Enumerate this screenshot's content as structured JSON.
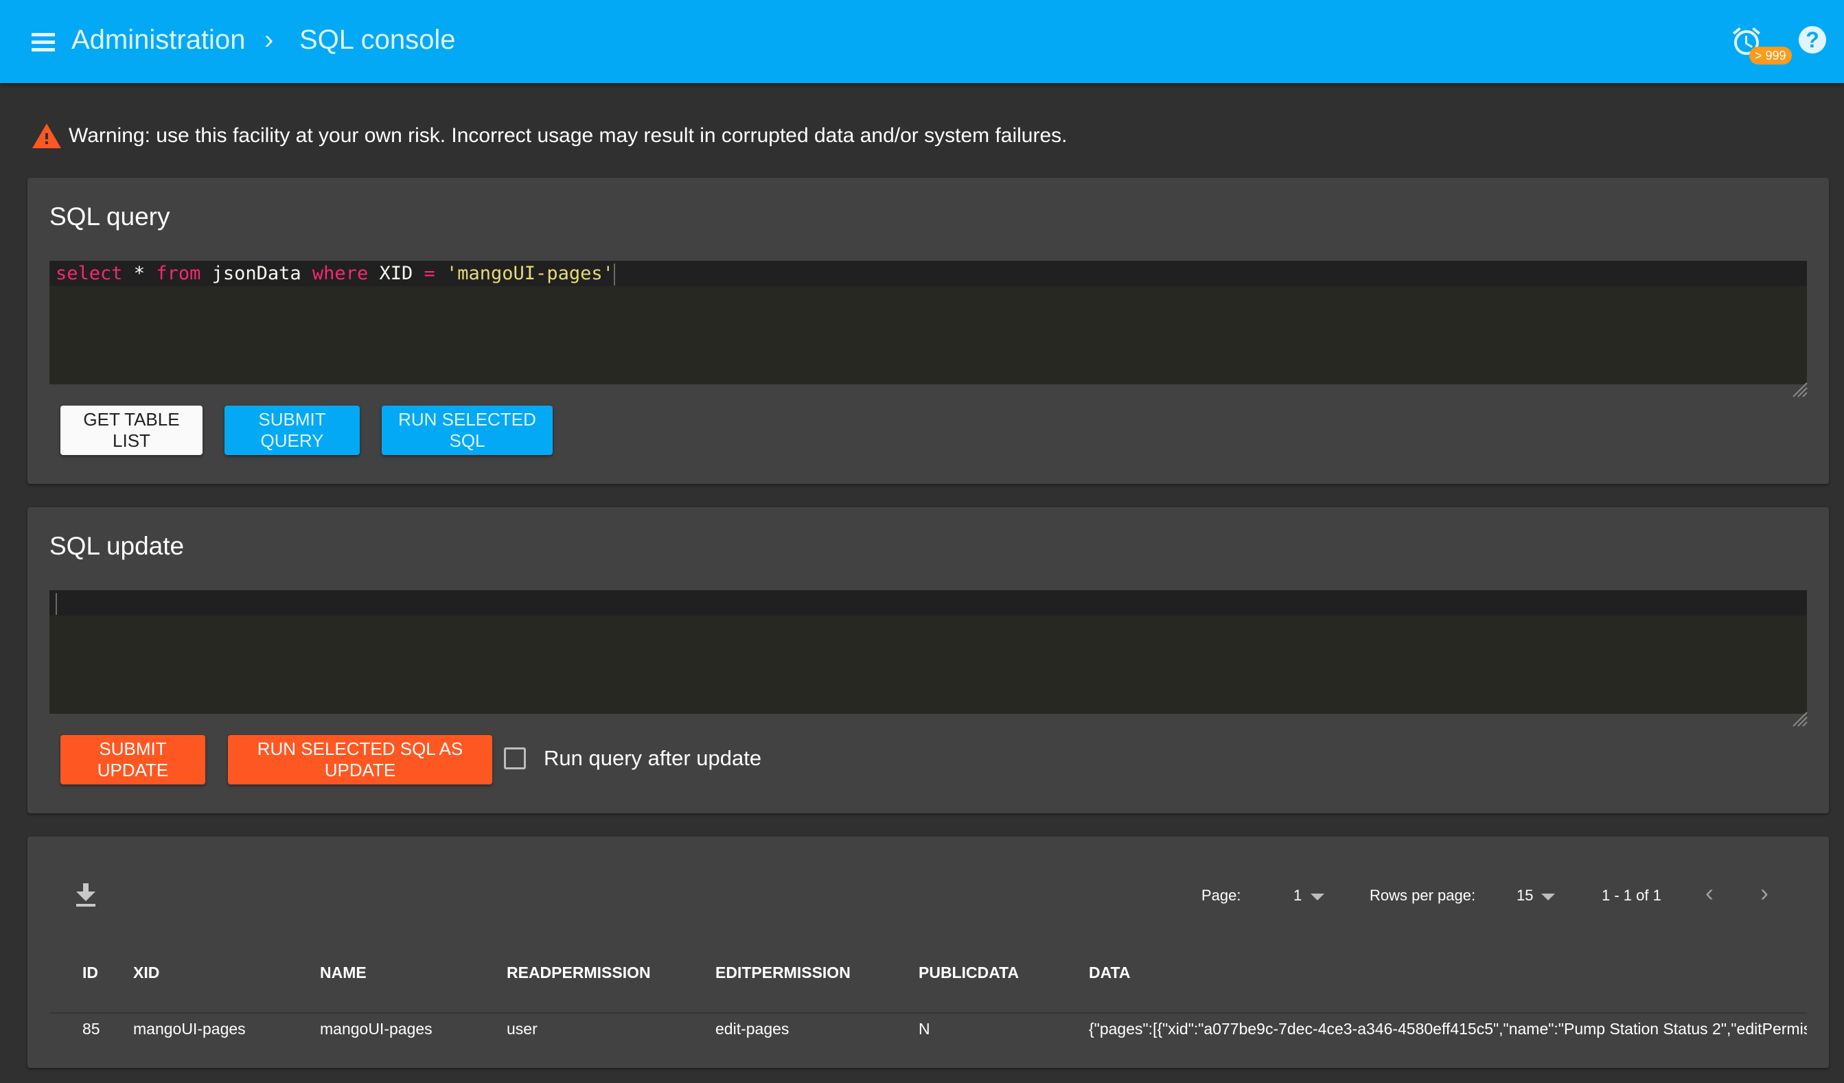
{
  "header": {
    "breadcrumb_parent": "Administration",
    "breadcrumb_separator": "›",
    "breadcrumb_current": "SQL console",
    "alarm_badge": "> 999",
    "help_label": "?"
  },
  "warning": {
    "text": "Warning: use this facility at your own risk. Incorrect usage may result in corrupted data and/or system failures."
  },
  "query_card": {
    "title": "SQL query",
    "editor": {
      "tokens": [
        {
          "type": "kw",
          "text": "select"
        },
        {
          "type": "id",
          "text": " * "
        },
        {
          "type": "kw",
          "text": "from"
        },
        {
          "type": "id",
          "text": " jsonData "
        },
        {
          "type": "kw",
          "text": "where"
        },
        {
          "type": "id",
          "text": " XID "
        },
        {
          "type": "kw",
          "text": "="
        },
        {
          "type": "id",
          "text": " "
        },
        {
          "type": "str",
          "text": "'mangoUI-pages'"
        }
      ]
    },
    "buttons": {
      "get_table_list": "Get table list",
      "submit_query": "Submit query",
      "run_selected": "Run selected SQL"
    }
  },
  "update_card": {
    "title": "SQL update",
    "editor_value": "",
    "buttons": {
      "submit_update": "Submit update",
      "run_selected_update": "Run selected SQL as update"
    },
    "run_query_after_update": {
      "label": "Run query after update",
      "checked": false
    }
  },
  "results": {
    "pager": {
      "page_label": "Page:",
      "page_value": "1",
      "rows_label": "Rows per page:",
      "rows_value": "15",
      "range_text": "1 - 1 of 1"
    },
    "columns": [
      "ID",
      "XID",
      "NAME",
      "READPERMISSION",
      "EDITPERMISSION",
      "PUBLICDATA",
      "DATA"
    ],
    "rows": [
      [
        "85",
        "mangoUI-pages",
        "mangoUI-pages",
        "user",
        "edit-pages",
        "N",
        "{\"pages\":[{\"xid\":\"a077be9c-7dec-4ce3-a346-4580eff415c5\",\"name\":\"Pump Station Status 2\",\"editPermis"
      ]
    ]
  },
  "colors": {
    "primary": "#03a9f4",
    "accent": "#ff5722",
    "badge": "#ff9a1a",
    "background": "#303030",
    "card": "#424242"
  }
}
